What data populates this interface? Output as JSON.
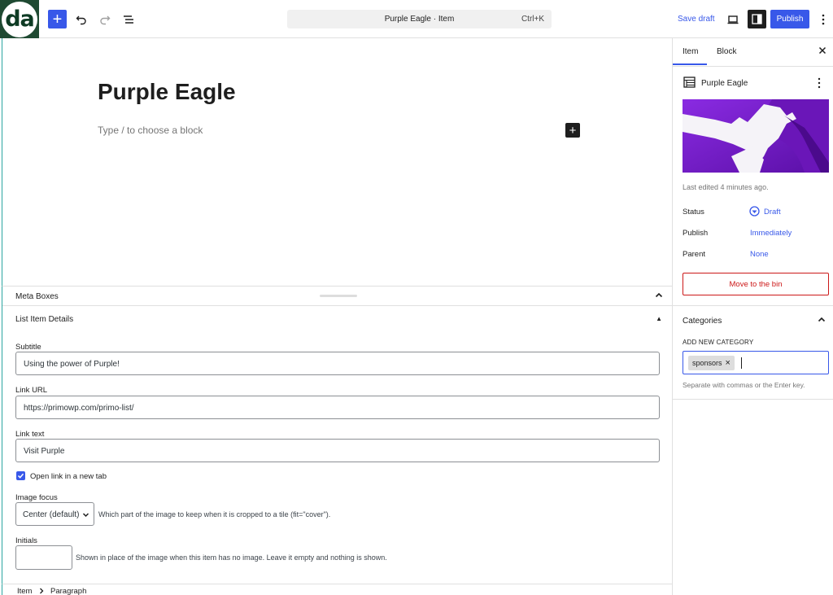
{
  "logo": {
    "text": "da"
  },
  "toolbar": {
    "document_title": "Purple Eagle · Item",
    "shortcut": "Ctrl+K",
    "save_draft": "Save draft",
    "publish": "Publish"
  },
  "editor": {
    "title": "Purple Eagle",
    "placeholder": "Type / to choose a block"
  },
  "meta": {
    "header": "Meta Boxes",
    "box_title": "List Item Details",
    "subtitle_label": "Subtitle",
    "subtitle_value": "Using the power of Purple!",
    "link_url_label": "Link URL",
    "link_url_value": "https://primowp.com/primo-list/",
    "link_text_label": "Link text",
    "link_text_value": "Visit Purple",
    "new_tab_label": "Open link in a new tab",
    "new_tab_checked": true,
    "image_focus_label": "Image focus",
    "image_focus_value": "Center (default)",
    "image_focus_help": "Which part of the image to keep when it is cropped to a tile (fit=\"cover\").",
    "initials_label": "Initials",
    "initials_help": "Shown in place of the image when this item has no image. Leave it empty and nothing is shown."
  },
  "breadcrumb": {
    "items": [
      "Item",
      "Paragraph"
    ]
  },
  "sidebar": {
    "tabs": [
      "Item",
      "Block"
    ],
    "doc_title": "Purple Eagle",
    "last_edited": "Last edited 4 minutes ago.",
    "status_label": "Status",
    "status_value": "Draft",
    "publish_label": "Publish",
    "publish_value": "Immediately",
    "parent_label": "Parent",
    "parent_value": "None",
    "bin": "Move to the bin",
    "categories_title": "Categories",
    "add_new_label": "ADD NEW CATEGORY",
    "token": "sponsors",
    "token_help": "Separate with commas or the Enter key."
  },
  "colors": {
    "accent": "#3858e9",
    "danger": "#cc1818",
    "image_purple": "#7a1fc4"
  }
}
